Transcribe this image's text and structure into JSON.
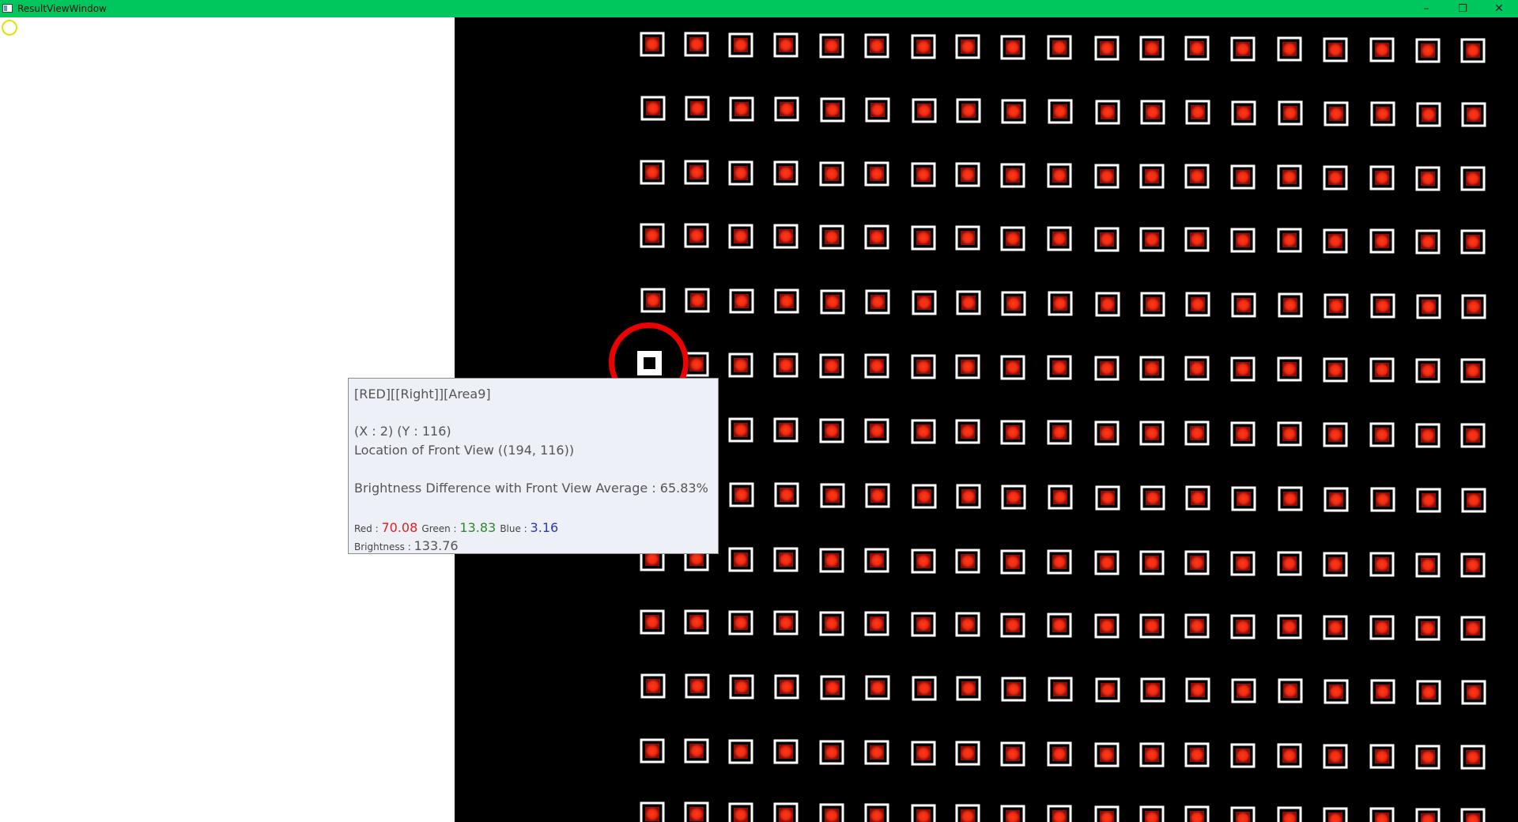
{
  "window": {
    "title": "ResultViewWindow",
    "controls": {
      "minimize_icon": "minimize-icon",
      "maximize_icon": "restore-icon",
      "close_icon": "close-icon",
      "minimize_glyph": "–",
      "maximize_glyph": "❐",
      "close_glyph": "✕"
    },
    "titlebar_color": "#00c65e"
  },
  "viewer": {
    "background_color": "#000000",
    "cell_color": "#ee2a10",
    "cell_border_color": "#ffffff",
    "selection_ring_color": "#ee0000"
  },
  "tooltip": {
    "header": "[RED][[Right]][Area9]",
    "coords": "(X : 2) (Y : 116)",
    "front_view_location": "Location of Front View ((194, 116))",
    "brightness_difference": "Brightness Difference with Front View Average : 65.83%",
    "red_label": "Red : ",
    "red_value": "70.08",
    "green_label": "Green : ",
    "green_value": "13.83",
    "blue_label": "Blue : ",
    "blue_value": "3.16",
    "brightness_label": "Brightness : ",
    "brightness_value": "133.76",
    "red_color": "#e02020",
    "green_color": "#2a8a2a",
    "blue_color": "#2a35c8"
  }
}
